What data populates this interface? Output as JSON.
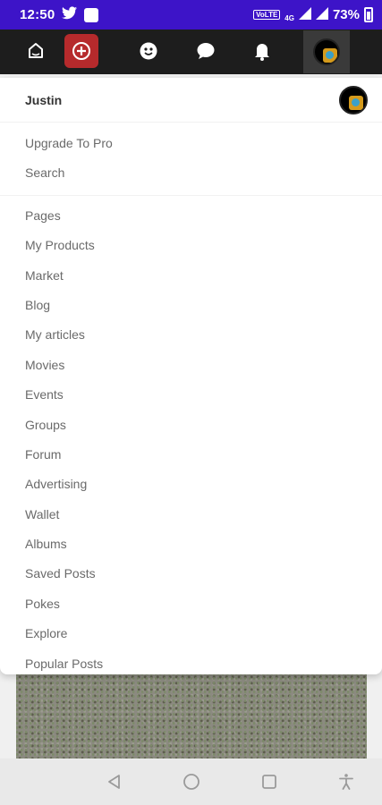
{
  "status_bar": {
    "time": "12:50",
    "battery_percent": "73%",
    "network_label": "VoLTE",
    "network_type": "4G",
    "icons": [
      "twitter-icon",
      "notification-square-icon",
      "wifi-calling-icon",
      "signal-icon",
      "battery-icon"
    ]
  },
  "navbar": {
    "icons": [
      "home-icon",
      "create-plus-icon",
      "smiley-icon",
      "chat-icon",
      "bell-icon",
      "profile-avatar"
    ],
    "accent_color": "#b62a2c"
  },
  "menu": {
    "user_name": "Justin",
    "top_items": [
      "Upgrade To Pro",
      "Search"
    ],
    "items": [
      "Pages",
      "My Products",
      "Market",
      "Blog",
      "My articles",
      "Movies",
      "Events",
      "Groups",
      "Forum",
      "Advertising",
      "Wallet",
      "Albums",
      "Saved Posts",
      "Pokes",
      "Explore",
      "Popular Posts"
    ]
  },
  "system_nav": {
    "icons": [
      "back-icon",
      "home-circle-icon",
      "recents-icon",
      "accessibility-icon"
    ]
  },
  "colors": {
    "status_bar": "#3d14c8",
    "navbar": "#1d1d1d",
    "menu_text": "#6a6a6a"
  }
}
